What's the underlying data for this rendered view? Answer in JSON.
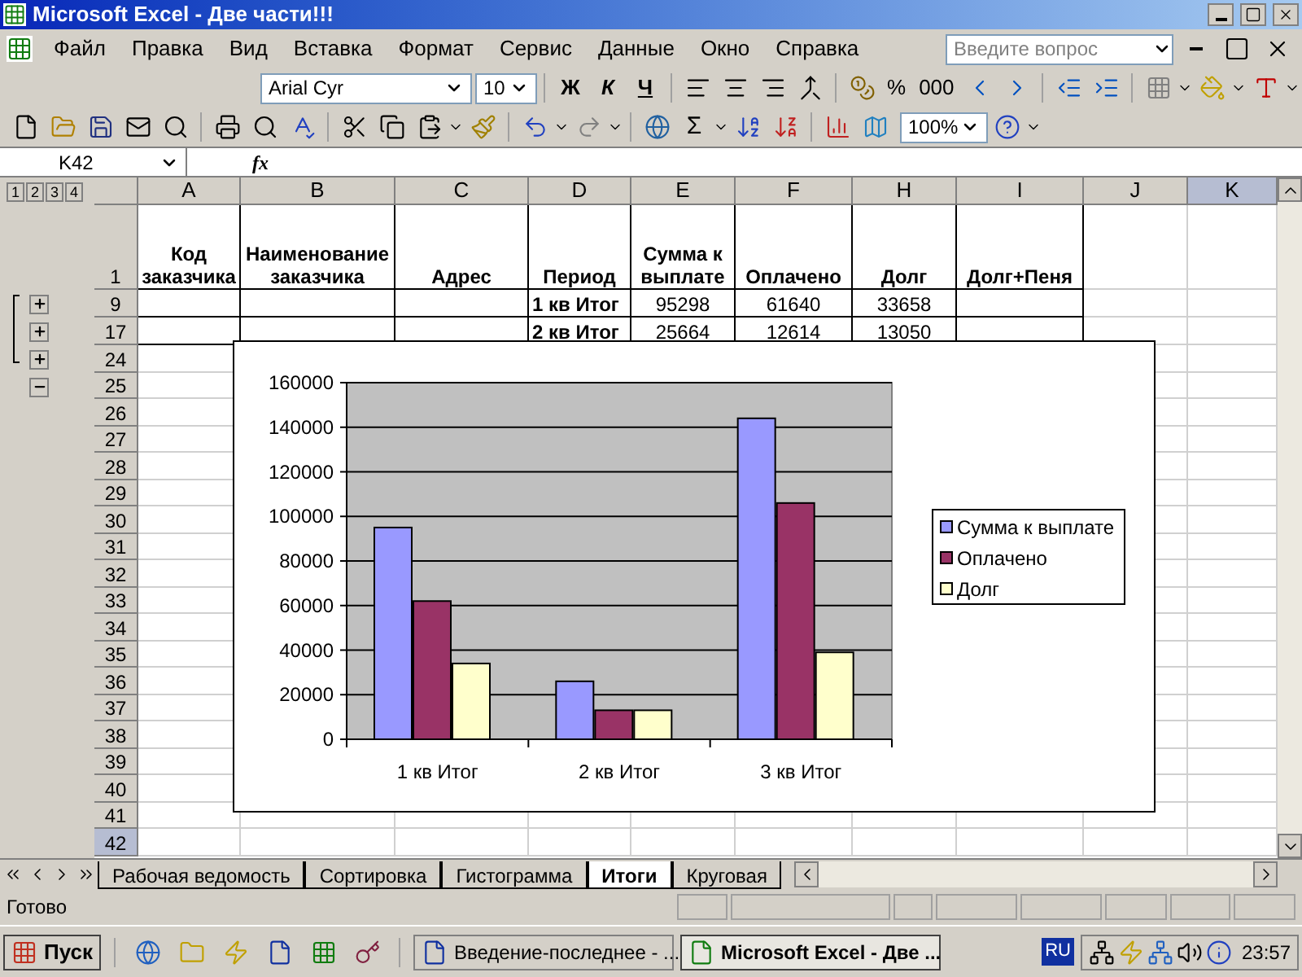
{
  "window": {
    "title": "Microsoft Excel - Две части!!!"
  },
  "menu": {
    "items": [
      "Файл",
      "Правка",
      "Вид",
      "Вставка",
      "Формат",
      "Сервис",
      "Данные",
      "Окно",
      "Справка"
    ],
    "help_search": {
      "placeholder": "Введите вопрос"
    }
  },
  "formatting_toolbar": {
    "font": "Arial Cyr",
    "size": "10",
    "style_buttons": [
      "Ж",
      "К",
      "Ч"
    ],
    "number_buttons": [
      "%",
      "000"
    ]
  },
  "standard_toolbar": {
    "sum_button": "Σ",
    "zoom": "100%"
  },
  "formula_bar": {
    "name_box": "K42",
    "fx_label": "fx"
  },
  "sheet": {
    "outline_levels": [
      "1",
      "2",
      "3",
      "4"
    ],
    "outline_buttons": [
      {
        "expanded": false
      },
      {
        "expanded": false
      },
      {
        "expanded": false
      },
      {
        "expanded": true
      }
    ],
    "columns": [
      {
        "label": "A",
        "selected": false
      },
      {
        "label": "B",
        "selected": false
      },
      {
        "label": "C",
        "selected": false
      },
      {
        "label": "D",
        "selected": false
      },
      {
        "label": "E",
        "selected": false
      },
      {
        "label": "F",
        "selected": false
      },
      {
        "label": "H",
        "selected": false
      },
      {
        "label": "I",
        "selected": false
      },
      {
        "label": "J",
        "selected": false
      },
      {
        "label": "K",
        "selected": true
      }
    ],
    "rows": [
      {
        "number": "1",
        "kind": "header",
        "selected": false,
        "cells": [
          "Код заказчика",
          "Наименование заказчика",
          "Адрес",
          "Период",
          "Сумма к выплате",
          "Оплачено",
          "Долг",
          "Долг+Пеня"
        ]
      },
      {
        "number": "9",
        "kind": "total",
        "selected": false,
        "cells": [
          "",
          "",
          "",
          "1 кв Итог",
          "95298",
          "61640",
          "33658",
          ""
        ]
      },
      {
        "number": "17",
        "kind": "total",
        "selected": false,
        "cells": [
          "",
          "",
          "",
          "2 кв Итог",
          "25664",
          "12614",
          "13050",
          ""
        ]
      },
      {
        "number": "24",
        "kind": "plain",
        "selected": false,
        "cells": []
      },
      {
        "number": "25",
        "kind": "plain",
        "selected": false,
        "cells": []
      },
      {
        "number": "26",
        "kind": "plain",
        "selected": false,
        "cells": []
      },
      {
        "number": "27",
        "kind": "plain",
        "selected": false,
        "cells": []
      },
      {
        "number": "28",
        "kind": "plain",
        "selected": false,
        "cells": []
      },
      {
        "number": "29",
        "kind": "plain",
        "selected": false,
        "cells": []
      },
      {
        "number": "30",
        "kind": "plain",
        "selected": false,
        "cells": []
      },
      {
        "number": "31",
        "kind": "plain",
        "selected": false,
        "cells": []
      },
      {
        "number": "32",
        "kind": "plain",
        "selected": false,
        "cells": []
      },
      {
        "number": "33",
        "kind": "plain",
        "selected": false,
        "cells": []
      },
      {
        "number": "34",
        "kind": "plain",
        "selected": false,
        "cells": []
      },
      {
        "number": "35",
        "kind": "plain",
        "selected": false,
        "cells": []
      },
      {
        "number": "36",
        "kind": "plain",
        "selected": false,
        "cells": []
      },
      {
        "number": "37",
        "kind": "plain",
        "selected": false,
        "cells": []
      },
      {
        "number": "38",
        "kind": "plain",
        "selected": false,
        "cells": []
      },
      {
        "number": "39",
        "kind": "plain",
        "selected": false,
        "cells": []
      },
      {
        "number": "40",
        "kind": "plain",
        "selected": false,
        "cells": []
      },
      {
        "number": "41",
        "kind": "plain",
        "selected": false,
        "cells": []
      },
      {
        "number": "42",
        "kind": "plain",
        "selected": true,
        "cells": []
      }
    ],
    "chart": {
      "chart_data": {
        "type": "bar",
        "categories": [
          "1 кв Итог",
          "2 кв Итог",
          "3 кв Итог"
        ],
        "series": [
          {
            "name": "Сумма к выплате",
            "color": "#9999ff",
            "values": [
              95000,
              26000,
              144000
            ]
          },
          {
            "name": "Оплачено",
            "color": "#993366",
            "values": [
              62000,
              13000,
              106000
            ]
          },
          {
            "name": "Долг",
            "color": "#ffffcc",
            "values": [
              34000,
              13000,
              39000
            ]
          }
        ],
        "ylim": [
          0,
          160000
        ],
        "yticks": [
          0,
          20000,
          40000,
          60000,
          80000,
          100000,
          120000,
          140000,
          160000
        ],
        "grid": true,
        "legend": true
      }
    }
  },
  "sheet_tabs": [
    {
      "label": "Рабочая ведомость",
      "selected": false
    },
    {
      "label": "Сортировка",
      "selected": false
    },
    {
      "label": "Гистограмма",
      "selected": false
    },
    {
      "label": "Итоги",
      "selected": true
    },
    {
      "label": "Круговая",
      "selected": false
    }
  ],
  "status_bar": {
    "text": "Готово"
  },
  "taskbar": {
    "start": "Пуск",
    "tasks": [
      {
        "label": "Введение-последнее - ...",
        "selected": false
      },
      {
        "label": "Microsoft Excel - Две ...",
        "selected": true
      }
    ],
    "language": "RU",
    "clock": "23:57"
  }
}
